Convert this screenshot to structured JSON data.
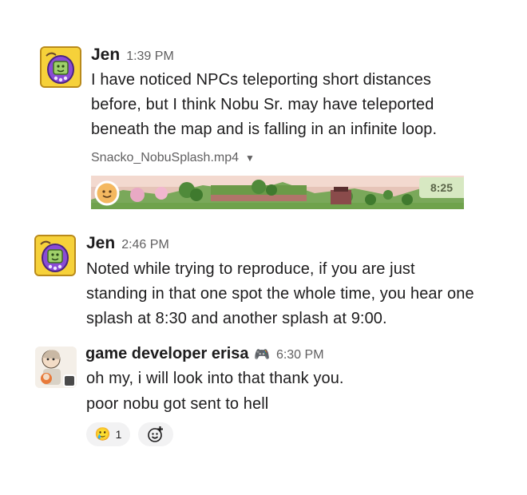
{
  "messages": [
    {
      "author": "Jen",
      "time": "1:39 PM",
      "lines": [
        "I have noticed NPCs teleporting short distances",
        "before, but I think Nobu Sr. may have teleported",
        "beneath the map and is falling in an infinite loop."
      ],
      "attachment": {
        "filename": "Snacko_NobuSplash.mp4",
        "video_time": "8:25"
      }
    },
    {
      "author": "Jen",
      "time": "2:46 PM",
      "lines": [
        "Noted while trying to reproduce, if you are just",
        "standing in that one spot the whole time, you hear one",
        "splash at 8:30 and another splash at 9:00."
      ]
    },
    {
      "author": "game developer erisa",
      "author_emoji": "🎮",
      "time": "6:30 PM",
      "lines": [
        "oh my, i will look into that thank you.",
        "poor nobu got sent to hell"
      ],
      "reactions": [
        {
          "emoji": "🥲",
          "count": "1"
        }
      ],
      "add_reaction_icon": "add-emoji-icon"
    }
  ],
  "colors": {
    "text": "#1d1c1d",
    "muted": "#616061",
    "reaction_bg": "#f2f2f3",
    "avatar_yellow": "#f6d13a"
  }
}
